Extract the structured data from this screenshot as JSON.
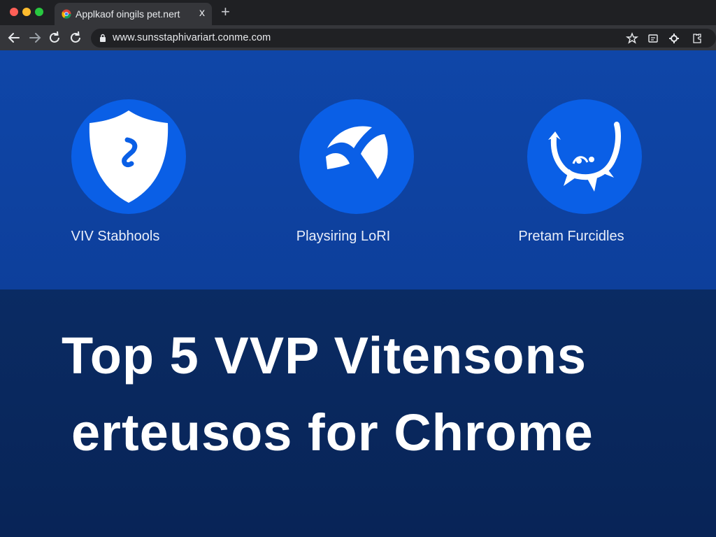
{
  "browser": {
    "tab": {
      "title": "Applkaof oingils pet.nert",
      "close": "x"
    },
    "new_tab": "+",
    "url": "www.sunsstaphivariart.conme.com",
    "colors": {
      "tabstrip": "#1f2023",
      "toolbar": "#35363a",
      "omnibox": "#202124"
    }
  },
  "hero": {
    "features": [
      {
        "label": "VIV Stabhools",
        "icon": "shield-icon"
      },
      {
        "label": "Playsiring LoRI",
        "icon": "globe-icon"
      },
      {
        "label": "Pretam Furcidles",
        "icon": "spiral-icon"
      }
    ],
    "colors": {
      "background": "#0f46a8",
      "circle": "#0a5fe6"
    }
  },
  "headline": {
    "line1": "Top 5 VVP Vitensons",
    "line2": "erteusos for Chrome"
  }
}
